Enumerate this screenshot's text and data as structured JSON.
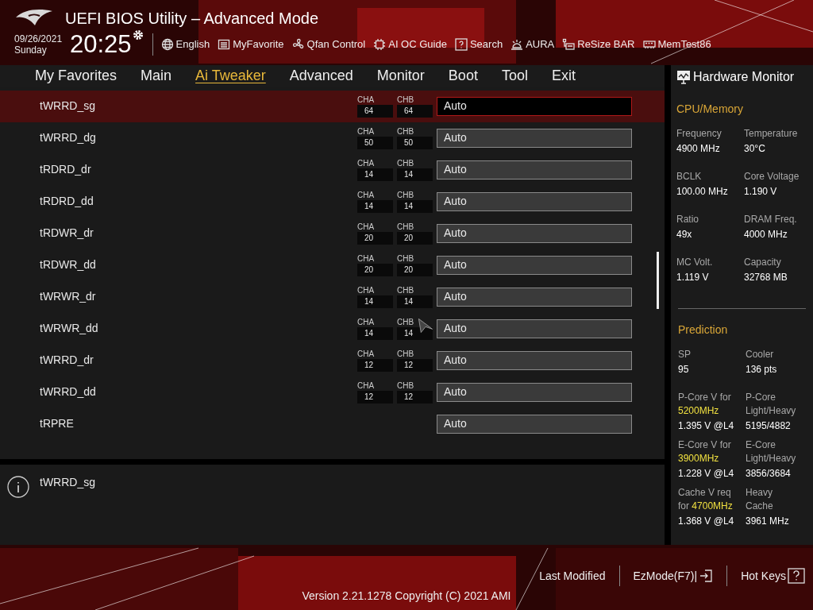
{
  "header": {
    "title": "UEFI BIOS Utility – Advanced Mode",
    "date": "09/26/2021",
    "day": "Sunday",
    "time": "20:25"
  },
  "toolbar": [
    {
      "label": "English",
      "kind": "globe"
    },
    {
      "label": "MyFavorite",
      "kind": "list"
    },
    {
      "label": "Qfan Control",
      "kind": "fan"
    },
    {
      "label": "AI OC Guide",
      "kind": "chip"
    },
    {
      "label": "Search",
      "kind": "help"
    },
    {
      "label": "AURA",
      "kind": "light"
    },
    {
      "label": "ReSize BAR",
      "kind": "bar"
    },
    {
      "label": "MemTest86",
      "kind": "memory"
    }
  ],
  "tabs": [
    {
      "label": "My Favorites",
      "selected": false
    },
    {
      "label": "Main",
      "selected": false
    },
    {
      "label": "Ai Tweaker",
      "selected": true
    },
    {
      "label": "Advanced",
      "selected": false
    },
    {
      "label": "Monitor",
      "selected": false
    },
    {
      "label": "Boot",
      "selected": false
    },
    {
      "label": "Tool",
      "selected": false
    },
    {
      "label": "Exit",
      "selected": false
    }
  ],
  "settings": [
    {
      "name": "tWRRD_sg",
      "selected": true,
      "channels": [
        {
          "label": "CHA",
          "value": "64"
        },
        {
          "label": "CHB",
          "value": "64"
        }
      ],
      "value": "Auto"
    },
    {
      "name": "tWRRD_dg",
      "selected": false,
      "channels": [
        {
          "label": "CHA",
          "value": "50"
        },
        {
          "label": "CHB",
          "value": "50"
        }
      ],
      "value": "Auto"
    },
    {
      "name": "tRDRD_dr",
      "selected": false,
      "channels": [
        {
          "label": "CHA",
          "value": "14"
        },
        {
          "label": "CHB",
          "value": "14"
        }
      ],
      "value": "Auto"
    },
    {
      "name": "tRDRD_dd",
      "selected": false,
      "channels": [
        {
          "label": "CHA",
          "value": "14"
        },
        {
          "label": "CHB",
          "value": "14"
        }
      ],
      "value": "Auto"
    },
    {
      "name": "tRDWR_dr",
      "selected": false,
      "channels": [
        {
          "label": "CHA",
          "value": "20"
        },
        {
          "label": "CHB",
          "value": "20"
        }
      ],
      "value": "Auto"
    },
    {
      "name": "tRDWR_dd",
      "selected": false,
      "channels": [
        {
          "label": "CHA",
          "value": "20"
        },
        {
          "label": "CHB",
          "value": "20"
        }
      ],
      "value": "Auto"
    },
    {
      "name": "tWRWR_dr",
      "selected": false,
      "channels": [
        {
          "label": "CHA",
          "value": "14"
        },
        {
          "label": "CHB",
          "value": "14"
        }
      ],
      "value": "Auto"
    },
    {
      "name": "tWRWR_dd",
      "selected": false,
      "channels": [
        {
          "label": "CHA",
          "value": "14"
        },
        {
          "label": "CHB",
          "value": "14"
        }
      ],
      "value": "Auto"
    },
    {
      "name": "tWRRD_dr",
      "selected": false,
      "channels": [
        {
          "label": "CHA",
          "value": "12"
        },
        {
          "label": "CHB",
          "value": "12"
        }
      ],
      "value": "Auto"
    },
    {
      "name": "tWRRD_dd",
      "selected": false,
      "channels": [
        {
          "label": "CHA",
          "value": "12"
        },
        {
          "label": "CHB",
          "value": "12"
        }
      ],
      "value": "Auto"
    },
    {
      "name": "tRPRE",
      "selected": false,
      "value": "Auto"
    }
  ],
  "help": {
    "text": "tWRRD_sg"
  },
  "hardware_monitor": {
    "title": "Hardware Monitor",
    "sections": [
      {
        "title": "CPU/Memory",
        "items": [
          {
            "label": "Frequency",
            "value": "4900 MHz"
          },
          {
            "label": "Temperature",
            "value": "30°C"
          },
          {
            "label": "BCLK",
            "value": "100.00 MHz"
          },
          {
            "label": "Core Voltage",
            "value": "1.190 V"
          },
          {
            "label": "Ratio",
            "value": "49x"
          },
          {
            "label": "DRAM Freq.",
            "value": "4000 MHz"
          },
          {
            "label": "MC Volt.",
            "value": "1.119 V"
          },
          {
            "label": "Capacity",
            "value": "32768 MB"
          }
        ]
      },
      {
        "title": "Prediction",
        "items": [
          {
            "label": "SP",
            "value": "95"
          },
          {
            "label": "Cooler",
            "value": "136 pts"
          },
          {
            "label": "P-Core V for",
            "highlight": "5200MHz",
            "value": "1.395 V @L4"
          },
          {
            "label": "P-Core Light/Heavy",
            "value": "5195/4882"
          },
          {
            "label": "E-Core V for",
            "highlight": "3900MHz",
            "value": "1.228 V @L4"
          },
          {
            "label": "E-Core Light/Heavy",
            "value": "3856/3684"
          },
          {
            "label": "Cache V req for",
            "highlight": "4700MHz",
            "value": "1.368 V @L4"
          },
          {
            "label": "Heavy Cache",
            "value": "3961 MHz"
          }
        ]
      }
    ]
  },
  "footer": {
    "buttons": [
      {
        "label": "Last Modified",
        "kind": "plain"
      },
      {
        "label": "EzMode(F7)|",
        "kind": "exit"
      },
      {
        "label": "Hot Keys",
        "kind": "help"
      }
    ],
    "version": "Version 2.21.1278 Copyright (C) 2021 AMI"
  }
}
